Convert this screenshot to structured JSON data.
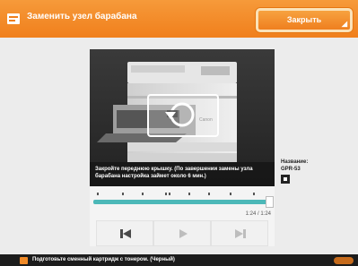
{
  "header": {
    "title": "Заменить узел барабана",
    "close_label": "Закрыть"
  },
  "video": {
    "brand": "Canon",
    "caption": "Закройте переднюю крышку. (По завершении замены узла барабана настройка займет около 6 мин.)",
    "time": "1:24 / 1:24"
  },
  "side": {
    "label": "Название:",
    "code": "GPR-53"
  },
  "bottom": {
    "status": "Подготовьте сменный картридж с тонером. (Черный)"
  },
  "colors": {
    "accent": "#f07f1c",
    "progress": "#4cb8b8"
  },
  "icons": [
    "menu-icon",
    "prev-icon",
    "play-icon",
    "next-icon",
    "replay-icon",
    "info-icon"
  ]
}
